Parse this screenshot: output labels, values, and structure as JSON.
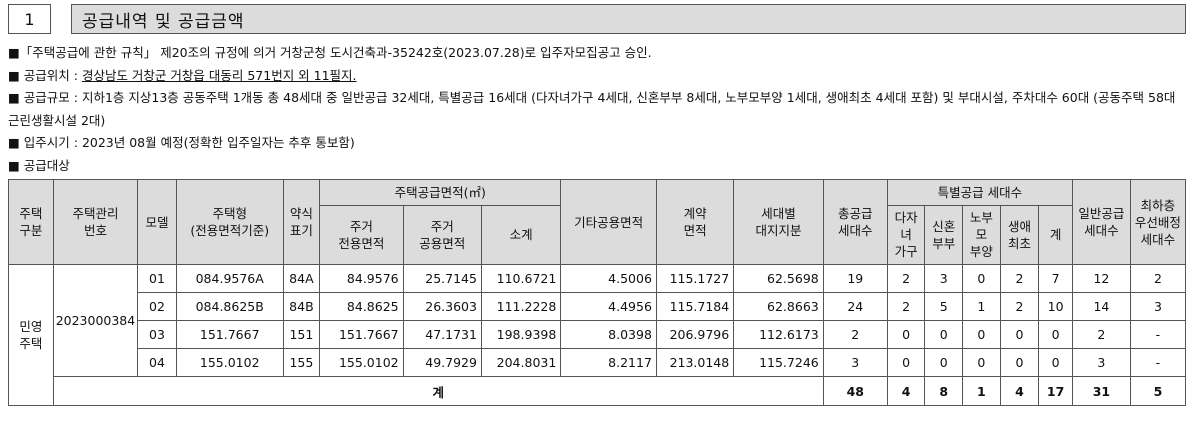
{
  "section": {
    "number": "1",
    "title": "공급내역 및 공급금액"
  },
  "notes": {
    "approval": "■「주택공급에 관한 규칙」 제20조의 규정에 의거 거창군청 도시건축과-35242호(2023.07.28)로 입주자모집공고 승인.",
    "location_prefix": "■ 공급위치 : ",
    "location_value": "경상남도 거창군 거창읍 대동리 571번지 외 11필지.",
    "scale": "■ 공급규모 : 지하1층 지상13층 공동주택 1개동 총 48세대 중 일반공급 32세대, 특별공급 16세대 (다자녀가구 4세대, 신혼부부 8세대, 노부모부양 1세대, 생애최초 4세대 포함) 및 부대시설, 주차대수 60대 (공동주택 58대 근린생활시설 2대)",
    "move_in": "■ 입주시기 : 2023년 08월 예정(정확한 입주일자는 추후 통보함)",
    "target": "■ 공급대상"
  },
  "table": {
    "headers": {
      "house_type_group": "주택\n구분",
      "mgmt_no": "주택관리\n번호",
      "model": "모델",
      "house_type": "주택형\n(전용면적기준)",
      "abbr": "약식\n표기",
      "supply_area": "주택공급면적(㎡)",
      "private_area": "주거\n전용면적",
      "common_area": "주거\n공용면적",
      "subtotal": "소계",
      "other_common": "기타공용면적",
      "contract_area": "계약\n면적",
      "land_share": "세대별\n대지지분",
      "total_units": "총공급\n세대수",
      "special_group": "특별공급 세대수",
      "multi_child": "다자\n녀\n가구",
      "newlywed": "신혼\n부부",
      "elderly": "노부\n모\n부양",
      "first_life": "생애\n최초",
      "special_sum": "계",
      "general_units": "일반공급\n세대수",
      "lowest_floor": "최하층\n우선배정\n세대수"
    },
    "group_label": "민영\n주택",
    "mgmt_number": "2023000384",
    "rows": [
      {
        "model": "01",
        "type": "084.9576A",
        "abbr": "84A",
        "private": "84.9576",
        "common": "25.7145",
        "subtotal": "110.6721",
        "other": "4.5006",
        "contract": "115.1727",
        "land": "62.5698",
        "total": "19",
        "multi": "2",
        "newly": "3",
        "elder": "0",
        "first": "2",
        "sp_sum": "7",
        "general": "12",
        "lowest": "2"
      },
      {
        "model": "02",
        "type": "084.8625B",
        "abbr": "84B",
        "private": "84.8625",
        "common": "26.3603",
        "subtotal": "111.2228",
        "other": "4.4956",
        "contract": "115.7184",
        "land": "62.8663",
        "total": "24",
        "multi": "2",
        "newly": "5",
        "elder": "1",
        "first": "2",
        "sp_sum": "10",
        "general": "14",
        "lowest": "3"
      },
      {
        "model": "03",
        "type": "151.7667",
        "abbr": "151",
        "private": "151.7667",
        "common": "47.1731",
        "subtotal": "198.9398",
        "other": "8.0398",
        "contract": "206.9796",
        "land": "112.6173",
        "total": "2",
        "multi": "0",
        "newly": "0",
        "elder": "0",
        "first": "0",
        "sp_sum": "0",
        "general": "2",
        "lowest": "-"
      },
      {
        "model": "04",
        "type": "155.0102",
        "abbr": "155",
        "private": "155.0102",
        "common": "49.7929",
        "subtotal": "204.8031",
        "other": "8.2117",
        "contract": "213.0148",
        "land": "115.7246",
        "total": "3",
        "multi": "0",
        "newly": "0",
        "elder": "0",
        "first": "0",
        "sp_sum": "0",
        "general": "3",
        "lowest": "-"
      }
    ],
    "total_row": {
      "label": "계",
      "total": "48",
      "multi": "4",
      "newly": "8",
      "elder": "1",
      "first": "4",
      "sp_sum": "17",
      "general": "31",
      "lowest": "5"
    }
  }
}
